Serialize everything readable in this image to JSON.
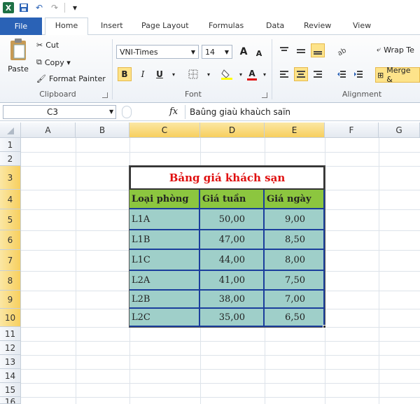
{
  "qat": {
    "logo": "X",
    "undo": "↶",
    "redo": "↷"
  },
  "tabs": [
    "File",
    "Home",
    "Insert",
    "Page Layout",
    "Formulas",
    "Data",
    "Review",
    "View"
  ],
  "ribbon": {
    "clipboard": {
      "paste": "Paste",
      "cut": "Cut",
      "copy": "Copy ▾",
      "format_painter": "Format Painter",
      "label": "Clipboard"
    },
    "font": {
      "name": "VNI-Times",
      "size": "14",
      "grow": "A",
      "shrink": "A",
      "bold": "B",
      "italic": "I",
      "underline": "U",
      "label": "Font",
      "fill_color": "#ffff00",
      "font_color": "#e01010"
    },
    "alignment": {
      "wrap": "Wrap Te",
      "merge": "Merge &",
      "label": "Alignment"
    }
  },
  "formula_bar": {
    "name_box": "C3",
    "fx": "fx",
    "formula": "Baûng giaù khaùch saïn"
  },
  "columns": [
    "A",
    "B",
    "C",
    "D",
    "E",
    "F",
    "G"
  ],
  "rows": [
    "1",
    "2",
    "3",
    "4",
    "5",
    "6",
    "7",
    "8",
    "9",
    "10",
    "11",
    "12",
    "13",
    "14",
    "15",
    "16"
  ],
  "table": {
    "title": "Bảng giá khách sạn",
    "headers": [
      "Loại phòng",
      "Giá tuần",
      "Giá ngày"
    ],
    "rows": [
      [
        "L1A",
        "50,00",
        "9,00"
      ],
      [
        "L1B",
        "47,00",
        "8,50"
      ],
      [
        "L1C",
        "44,00",
        "8,00"
      ],
      [
        "L2A",
        "41,00",
        "7,50"
      ],
      [
        "L2B",
        "38,00",
        "7,00"
      ],
      [
        "L2C",
        "35,00",
        "6,50"
      ]
    ]
  }
}
